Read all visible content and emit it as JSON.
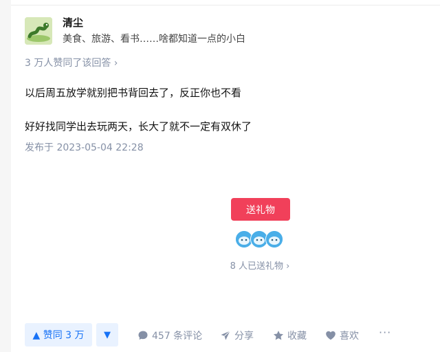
{
  "author": {
    "name": "清尘",
    "bio": "美食、旅游、看书……啥都知道一点的小白"
  },
  "votes_info": "3 万人赞同了该回答 ›",
  "content": {
    "paragraphs": [
      "以后周五放学就别把书背回去了，反正你也不看",
      "好好找同学出去玩两天，长大了就不一定有双休了"
    ],
    "publish_time": "发布于 2023-05-04 22:28"
  },
  "gift": {
    "button_label": "送礼物",
    "count_text": "8 人已送礼物 ›"
  },
  "actions": {
    "upvote_label": "▲ 赞同 3 万",
    "downvote_label": "▼",
    "comment_label": "457 条评论",
    "share_label": "分享",
    "favorite_label": "收藏",
    "like_label": "喜欢",
    "more_label": "···"
  },
  "colors": {
    "accent": "#1772f6",
    "gift": "#f1405a",
    "muted": "#8590a6"
  }
}
